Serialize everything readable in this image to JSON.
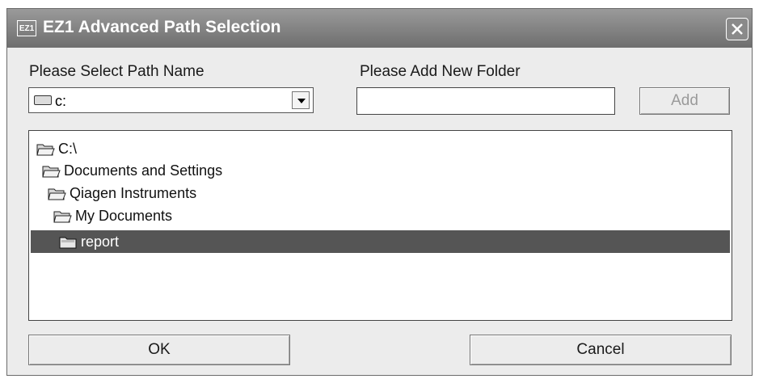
{
  "window": {
    "app_icon_label": "EZ1",
    "title": "EZ1 Advanced Path Selection"
  },
  "path": {
    "label": "Please Select Path Name",
    "selected_value": "c:",
    "drive_icon": "hard-drive-icon"
  },
  "new_folder": {
    "label": "Please Add New Folder",
    "value": "",
    "add_label": "Add"
  },
  "tree": {
    "items": [
      {
        "label": "C:\\",
        "level": 0,
        "selected": false
      },
      {
        "label": "Documents and Settings",
        "level": 1,
        "selected": false
      },
      {
        "label": "Qiagen Instruments",
        "level": 2,
        "selected": false
      },
      {
        "label": "My Documents",
        "level": 3,
        "selected": false
      },
      {
        "label": "report",
        "level": 4,
        "selected": true
      }
    ]
  },
  "buttons": {
    "ok": "OK",
    "cancel": "Cancel"
  },
  "colors": {
    "titlebar": "#7d7d7d",
    "selection": "#555555",
    "dialog_bg": "#ececec"
  }
}
